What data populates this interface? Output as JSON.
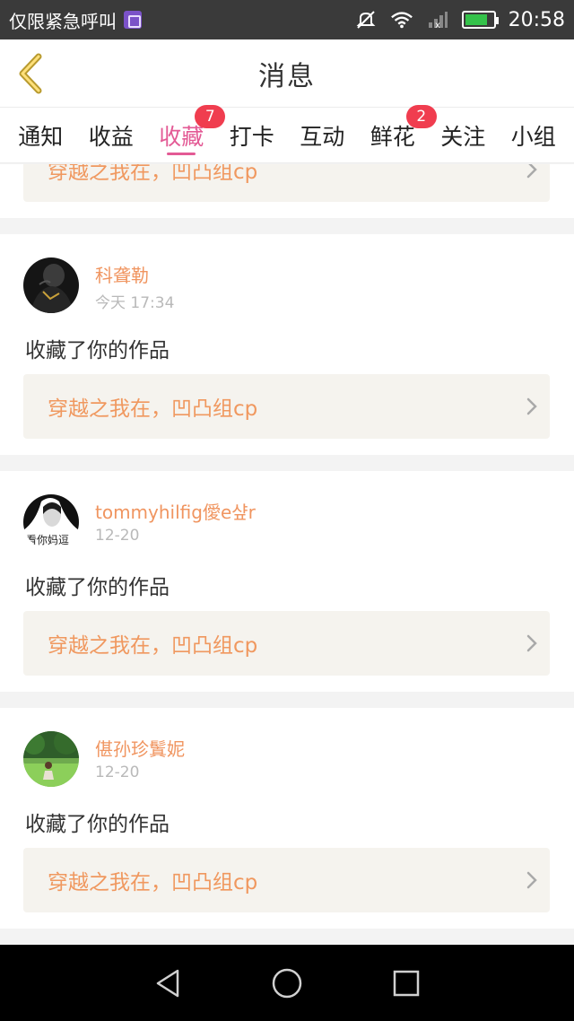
{
  "status_bar": {
    "left_text": "仅限紧急呼叫",
    "app_icon": "gallery-icon",
    "icons": [
      "mute-icon",
      "wifi-icon",
      "signal-icon",
      "battery-charging-icon"
    ],
    "battery_percent": 80,
    "time": "20:58"
  },
  "header": {
    "back_icon": "chevron-left-icon",
    "title": "消息"
  },
  "tabs": [
    {
      "label": "通知"
    },
    {
      "label": "收益"
    },
    {
      "label": "收藏",
      "badge": "7",
      "active": true
    },
    {
      "label": "打卡"
    },
    {
      "label": "互动"
    },
    {
      "label": "鲜花",
      "badge": "2"
    },
    {
      "label": "关注"
    },
    {
      "label": "小组"
    }
  ],
  "feed": {
    "partial_link": "穿越之我在，凹凸组cp",
    "items": [
      {
        "name": "科聋勒",
        "time": "今天 17:34",
        "action": "收藏了你的作品",
        "link": "穿越之我在，凹凸组cp"
      },
      {
        "name": "tommyhilfig僾e샾r",
        "time": "12-20",
        "action": "收藏了你的作品",
        "link": "穿越之我在，凹凸组cp",
        "avatar_text": "看你妈逗"
      },
      {
        "name": "偡孙珍鬒妮",
        "time": "12-20",
        "action": "收藏了你的作品",
        "link": "穿越之我在，凹凸组cp"
      }
    ]
  },
  "nav": {
    "icons": [
      "back-triangle-icon",
      "home-circle-icon",
      "recents-square-icon"
    ]
  },
  "colors": {
    "accent_pink": "#e35a95",
    "badge_red": "#f03d4f",
    "orange_text": "#f0985f"
  }
}
